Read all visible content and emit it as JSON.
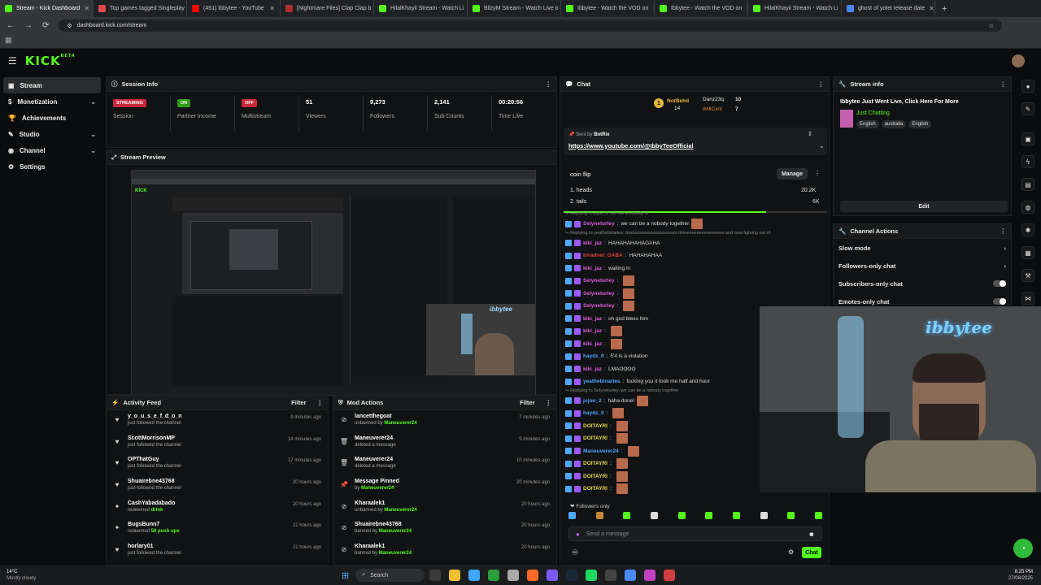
{
  "browser": {
    "tabs": [
      {
        "title": "Stream - Kick Dashboard",
        "color": "#53fc18",
        "active": true
      },
      {
        "title": "Top games tagged Singleplay",
        "color": "#e04a4a"
      },
      {
        "title": "(451) Ibbytee - YouTube",
        "color": "#ff0000"
      },
      {
        "title": "[Nightmare Files] Clap Clap b",
        "color": "#b03030"
      },
      {
        "title": "HilalKhayii Stream - Watch Li",
        "color": "#53fc18"
      },
      {
        "title": "BlizyM Stream - Watch Live o",
        "color": "#53fc18"
      },
      {
        "title": "Ibbytee - Watch the VOD on",
        "color": "#53fc18"
      },
      {
        "title": "Ibbytee - Watch the VOD on",
        "color": "#53fc18"
      },
      {
        "title": "HilalKhayii Stream - Watch Li",
        "color": "#53fc18"
      },
      {
        "title": "ghost of yotei release date",
        "color": "#4a8af4"
      }
    ],
    "url": "dashboard.kick.com/stream"
  },
  "brand": {
    "logo": "KICK",
    "beta": "BETA",
    "accent": "#53fc18"
  },
  "sidebar": {
    "items": [
      {
        "label": "Stream",
        "icon": "stream-icon",
        "active": true,
        "chevron": false
      },
      {
        "label": "Monetization",
        "icon": "dollar-icon",
        "chevron": true
      },
      {
        "label": "Achievements",
        "icon": "trophy-icon",
        "chevron": false
      },
      {
        "label": "Studio",
        "icon": "studio-icon",
        "chevron": true
      },
      {
        "label": "Channel",
        "icon": "user-icon",
        "chevron": true
      },
      {
        "label": "Settings",
        "icon": "gear-icon",
        "chevron": false
      }
    ]
  },
  "session": {
    "title": "Session Info",
    "stats": [
      {
        "value": "STREAMING",
        "badge": "red",
        "label": "Session"
      },
      {
        "value": "ON",
        "badge": "green",
        "label": "Partner Income"
      },
      {
        "value": "OFF",
        "badge": "red",
        "label": "Multistream"
      },
      {
        "value": "51",
        "label": "Viewers"
      },
      {
        "value": "9,273",
        "label": "Followers"
      },
      {
        "value": "2,141",
        "label": "Sub Counts"
      },
      {
        "value": "00:20:56",
        "label": "Time Live"
      }
    ]
  },
  "preview": {
    "title": "Stream Preview",
    "overlay_text": "ibbytee"
  },
  "activity": {
    "title": "Activity Feed",
    "filter": "Filter",
    "items": [
      {
        "name": "y_o_u_s_e_f_d_o_n",
        "desc": "just followed the channel",
        "highlight": "",
        "time": "9 minutes ago",
        "icon": "heart-icon"
      },
      {
        "name": "ScottMorrisonMP",
        "desc": "just followed the channel",
        "highlight": "",
        "time": "14 minutes ago",
        "icon": "heart-icon"
      },
      {
        "name": "OPThatGuy",
        "desc": "just followed the channel",
        "highlight": "",
        "time": "17 minutes ago",
        "icon": "heart-icon"
      },
      {
        "name": "Shuairebne43768",
        "desc": "just followed the channel",
        "highlight": "",
        "time": "20 hours ago",
        "icon": "heart-icon"
      },
      {
        "name": "CashYabadabado",
        "desc": "redeemed",
        "highlight": "drink",
        "time": "20 hours ago",
        "icon": "points-icon"
      },
      {
        "name": "BugsBunn7",
        "desc": "redeemed",
        "highlight": "50 push ups",
        "time": "21 hours ago",
        "icon": "points-icon"
      },
      {
        "name": "horlary01",
        "desc": "just followed the channel",
        "highlight": "",
        "time": "21 hours ago",
        "icon": "heart-icon"
      }
    ]
  },
  "mod": {
    "title": "Mod Actions",
    "filter": "Filter",
    "items": [
      {
        "name": "lancetthegoat",
        "desc": "unbanned by",
        "highlight": "Maneuverer24",
        "time": "7 minutes ago",
        "icon": "unban-icon"
      },
      {
        "name": "Maneuverer24",
        "desc": "deleted a message",
        "highlight": "",
        "time": "9 minutes ago",
        "icon": "trash-icon"
      },
      {
        "name": "Maneuverer24",
        "desc": "deleted a message",
        "highlight": "",
        "time": "10 minutes ago",
        "icon": "trash-icon"
      },
      {
        "name": "Message Pinned",
        "desc": "by",
        "highlight": "Maneuverer24",
        "time": "20 minutes ago",
        "icon": "pin-icon"
      },
      {
        "name": "Kharaalek1",
        "desc": "unbanned by",
        "highlight": "Maneuverer24",
        "time": "20 hours ago",
        "icon": "unban-icon"
      },
      {
        "name": "Shuairebne43768",
        "desc": "banned by",
        "highlight": "Maneuverer24",
        "time": "20 hours ago",
        "icon": "ban-icon"
      },
      {
        "name": "Kharaalek1",
        "desc": "banned by",
        "highlight": "Maneuverer24",
        "time": "20 hours ago",
        "icon": "ban-icon"
      }
    ]
  },
  "chat": {
    "title": "Chat",
    "top": [
      {
        "name": "NotBehd",
        "count": "14"
      },
      {
        "name": "Danz23q",
        "count": "10"
      },
      {
        "name": "WillCxnt",
        "count": "7"
      }
    ],
    "pinned": {
      "sent_by_label": "Sent by",
      "sender": "BotRix",
      "link": "https://www.youtube.com/@IbbyTeeOfficial"
    },
    "poll": {
      "title": "coin flip",
      "manage": "Manage",
      "options": [
        {
          "label": "1. heads",
          "value": "20.2K"
        },
        {
          "label": "2. tails",
          "value": "6K"
        }
      ],
      "progress": 0.77
    },
    "messages": [
      {
        "reply": "Replying to jojoo_2: dw me a nobody to"
      },
      {
        "user": "Selyneturley",
        "cls": "up",
        "text": "we can be a nobody together",
        "emote": true
      },
      {
        "reply": "Replying to yeathebinaries: Itssssssssssssssssssssss timeeeeeeeeeeeeeeee and now fighting out of"
      },
      {
        "user": "kiki_jaz",
        "cls": "up",
        "text": "HAHAHAHAHAGAHA"
      },
      {
        "user": "toradnet_GABA",
        "cls": "ur",
        "text": "HAHAHAHAA"
      },
      {
        "user": "kiki_jaz",
        "cls": "up",
        "text": "waiting in"
      },
      {
        "user": "Selyneturley",
        "cls": "up",
        "text": "",
        "emote": true
      },
      {
        "user": "Selyneturley",
        "cls": "up",
        "text": "",
        "emote": true
      },
      {
        "user": "Selyneturley",
        "cls": "up",
        "text": "",
        "emote": true
      },
      {
        "user": "kiki_jaz",
        "cls": "up",
        "text": "oh god bless him"
      },
      {
        "user": "kiki_jaz",
        "cls": "up",
        "text": "",
        "emote": true
      },
      {
        "user": "kiki_jaz",
        "cls": "up",
        "text": "",
        "emote": true
      },
      {
        "user": "haydz_0",
        "cls": "ub",
        "text": "5'4 is a violation"
      },
      {
        "user": "kiki_jaz",
        "cls": "up",
        "text": "LMAOOOO"
      },
      {
        "user": "yeathebinaries",
        "cls": "ub",
        "text": "fucking you it took me half and hour"
      },
      {
        "reply": "Replying to Selyneturley: we can be a nobody together"
      },
      {
        "user": "jojoo_2",
        "cls": "ub",
        "text": "haha done!",
        "emote": true
      },
      {
        "user": "haydz_0",
        "cls": "ub",
        "text": "",
        "emote": true
      },
      {
        "user": "DOITAYRI",
        "cls": "uy",
        "text": "",
        "emote": true
      },
      {
        "user": "DOITAYRI",
        "cls": "uy",
        "text": "",
        "emote": true
      },
      {
        "user": "Maneuverer24",
        "cls": "ub",
        "text": "",
        "emote": true
      },
      {
        "user": "DOITAYRI",
        "cls": "uy",
        "text": "",
        "emote": true
      },
      {
        "user": "DOITAYRI",
        "cls": "uy",
        "text": "",
        "emote": true
      },
      {
        "user": "DOITAYRI",
        "cls": "uy",
        "text": "",
        "emote": true
      }
    ],
    "followers_only": "Followers only",
    "placeholder": "Send a message",
    "send": "Chat"
  },
  "stream_info": {
    "title": "Stream info",
    "stream_title": "Ibbytee Just Went Live, Click Here For More",
    "category": "Just Chatting",
    "tags": [
      "English",
      "australia",
      "English"
    ],
    "edit": "Edit"
  },
  "channel_actions": {
    "title": "Channel Actions",
    "items": [
      {
        "label": "Slow mode",
        "control": "arrow"
      },
      {
        "label": "Followers-only chat",
        "control": "arrow"
      },
      {
        "label": "Subscribers-only chat",
        "control": "toggle"
      },
      {
        "label": "Emotes-only chat",
        "control": "toggle"
      }
    ]
  },
  "webcam": {
    "overlay_text": "ibbytee"
  },
  "taskbar": {
    "weather_temp": "14°C",
    "weather_desc": "Mostly cloudy",
    "search": "Search",
    "time": "8:25 PM",
    "date": "27/08/2025"
  }
}
